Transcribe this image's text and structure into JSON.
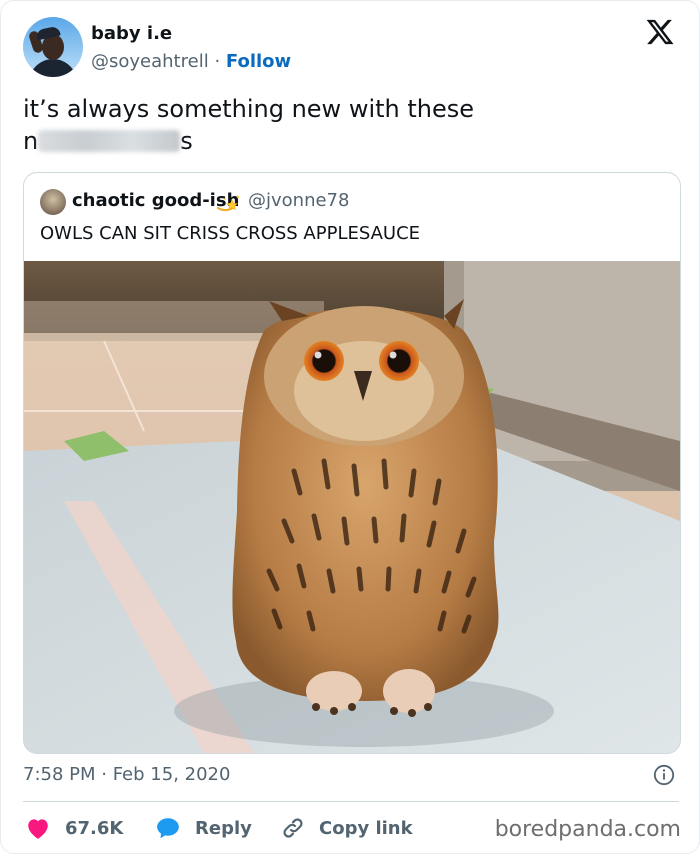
{
  "author": {
    "display_name": "baby i.e",
    "handle": "@soyeahtrell",
    "separator": "·",
    "follow_label": "Follow"
  },
  "tweet": {
    "text_line1": "it’s always something new with these",
    "text_line2_start": "n",
    "text_line2_end": "s"
  },
  "quoted": {
    "display_name": "chaotic good-ish",
    "handle": "@jvonne78",
    "text": "OWLS CAN SIT CRISS CROSS APPLESAUCE",
    "emoji_icon": "star-emoji-icon"
  },
  "meta": {
    "timestamp": "7:58 PM · Feb 15, 2020"
  },
  "actions": {
    "like_count": "67.6K",
    "reply_label": "Reply",
    "copy_label": "Copy link"
  },
  "watermark": "boredpanda.com",
  "colors": {
    "follow_blue": "#0b6bbf",
    "like_pink": "#f91880",
    "reply_blue": "#1d9bf0",
    "muted_text": "#536471"
  }
}
